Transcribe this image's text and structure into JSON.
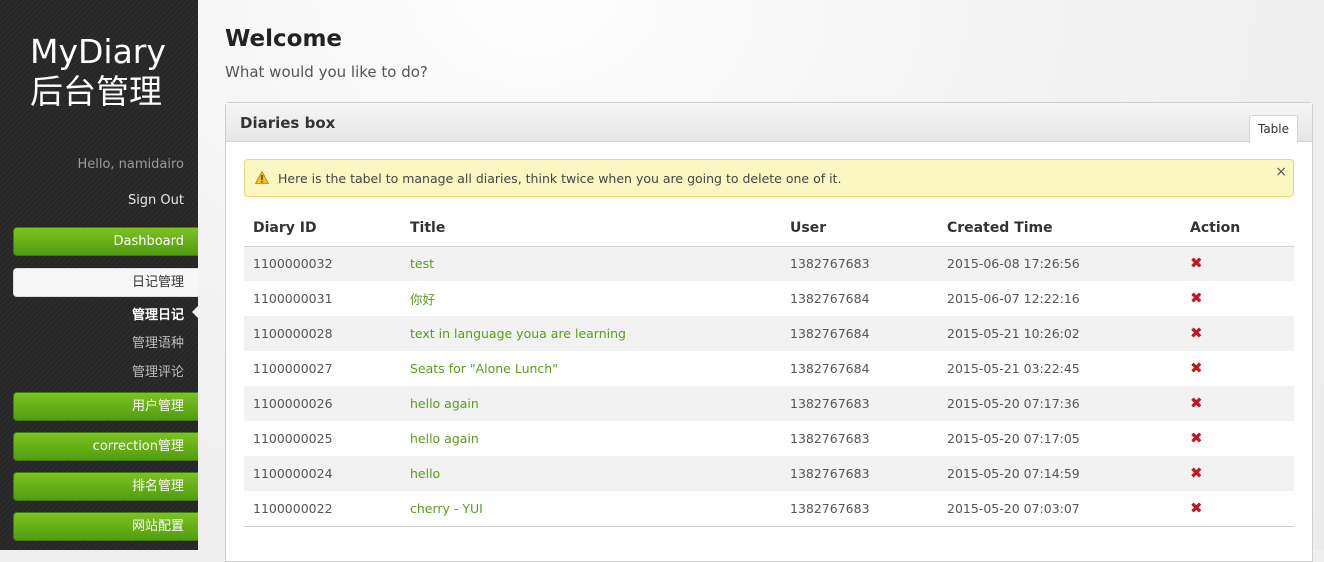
{
  "sidebar": {
    "logo_line1": "MyDiary",
    "logo_line2": "后台管理",
    "greeting": "Hello, namidairo",
    "sign_out": "Sign Out",
    "nav": {
      "dashboard": "Dashboard",
      "diary_mgmt": "日记管理",
      "sub_manage_diary": "管理日记",
      "sub_manage_language": "管理语种",
      "sub_manage_comments": "管理评论",
      "user_mgmt": "用户管理",
      "correction_mgmt": "correction管理",
      "ranking_mgmt": "排名管理",
      "site_config": "网站配置"
    }
  },
  "header": {
    "title": "Welcome",
    "subtitle": "What would you like to do?"
  },
  "box": {
    "title": "Diaries box",
    "tab_label": "Table",
    "alert_text": "Here is the tabel to manage all diaries, think twice when you are going to delete one of it.",
    "alert_close": "×",
    "columns": {
      "id": "Diary ID",
      "title": "Title",
      "user": "User",
      "created": "Created Time",
      "action": "Action"
    },
    "delete_glyph": "✖",
    "rows": [
      {
        "id": "1100000032",
        "title": "test",
        "user": "1382767683",
        "created": "2015-06-08 17:26:56"
      },
      {
        "id": "1100000031",
        "title": "你好",
        "user": "1382767684",
        "created": "2015-06-07 12:22:16"
      },
      {
        "id": "1100000028",
        "title": "text in language youa are learning",
        "user": "1382767684",
        "created": "2015-05-21 10:26:02"
      },
      {
        "id": "1100000027",
        "title": "Seats for \"Alone Lunch\"",
        "user": "1382767684",
        "created": "2015-05-21 03:22:45"
      },
      {
        "id": "1100000026",
        "title": "hello again",
        "user": "1382767683",
        "created": "2015-05-20 07:17:36"
      },
      {
        "id": "1100000025",
        "title": "hello again",
        "user": "1382767683",
        "created": "2015-05-20 07:17:05"
      },
      {
        "id": "1100000024",
        "title": "hello",
        "user": "1382767683",
        "created": "2015-05-20 07:14:59"
      },
      {
        "id": "1100000022",
        "title": "cherry - YUI",
        "user": "1382767683",
        "created": "2015-05-20 07:03:07"
      }
    ]
  },
  "icons": {
    "alert": "warning-triangle-icon",
    "close": "close-icon",
    "delete": "delete-x-icon"
  },
  "colors": {
    "nav_green": "#6ab31a",
    "link_green": "#5a9d1a",
    "delete_red": "#c4161c",
    "alert_bg": "#fbf7c3"
  }
}
